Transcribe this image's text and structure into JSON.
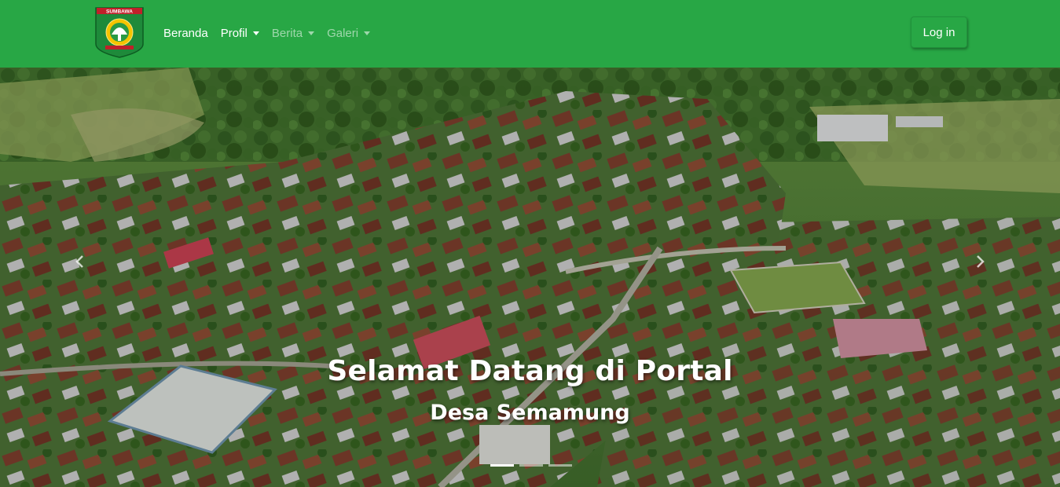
{
  "brand": {
    "logo_text": "SUMBAWA"
  },
  "nav": {
    "items": [
      {
        "label": "Beranda",
        "dropdown": false
      },
      {
        "label": "Profil",
        "dropdown": true
      },
      {
        "label": "Berita",
        "dropdown": true
      },
      {
        "label": "Galeri",
        "dropdown": true
      }
    ],
    "login_label": "Log in"
  },
  "carousel": {
    "title": "Selamat Datang di Portal",
    "subtitle": "Desa Semamung",
    "slide_count": 3,
    "active_slide": 1,
    "prev_icon": "chevron-left-icon",
    "next_icon": "chevron-right-icon"
  },
  "colors": {
    "navbar": "#28a745",
    "text_on_nav": "#ffffff"
  }
}
